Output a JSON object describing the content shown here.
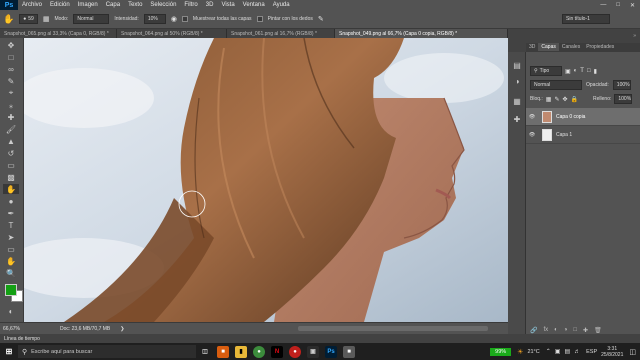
{
  "app": {
    "logo": "Ps"
  },
  "menu": [
    "Archivo",
    "Edición",
    "Imagen",
    "Capa",
    "Texto",
    "Selección",
    "Filtro",
    "3D",
    "Vista",
    "Ventana",
    "Ayuda"
  ],
  "options": {
    "brush_size": "59",
    "mode_label": "Modo:",
    "mode_value": "Normal",
    "intensity_label": "Intensidad:",
    "intensity_value": "10%",
    "sample_all_label": "Muestrear todas las capas",
    "finger_paint_label": "Pintar con los dedos",
    "workspace": "Sin título-1"
  },
  "tabs": [
    "Snapshot_065.png al 33,3% (Capa 0, RGB/8) *",
    "Snapshot_064.png al 50% (RGB/8) *",
    "Snapshot_061.png al 16,7% (RGB/8) *",
    "Snapshot_049.png al 66,7% (Capa 0 copia, RGB/8) *"
  ],
  "status": {
    "zoom": "66,67%",
    "doc": "Doc: 23,6 MB/70,7 MB"
  },
  "timeline_label": "Línea de tiempo",
  "panel": {
    "tabs": [
      "3D",
      "Capas",
      "Canales",
      "Propiedades"
    ],
    "filter_kind": "Tipo",
    "blend_mode": "Normal",
    "opacity_label": "Opacidad:",
    "opacity_value": "100%",
    "lock_label": "Bloq.:",
    "fill_label": "Relleno:",
    "fill_value": "100%",
    "layers": [
      "Capa 0 copia",
      "Capa 1"
    ]
  },
  "taskbar": {
    "search_placeholder": "Escribe aquí para buscar",
    "battery": "99%",
    "temperature": "21°C",
    "language": "ESP",
    "time": "3:31",
    "date": "25/8/2021"
  },
  "colors": {
    "foreground": "#14a014",
    "background": "#ffffff",
    "accent": "#31a8ff"
  }
}
